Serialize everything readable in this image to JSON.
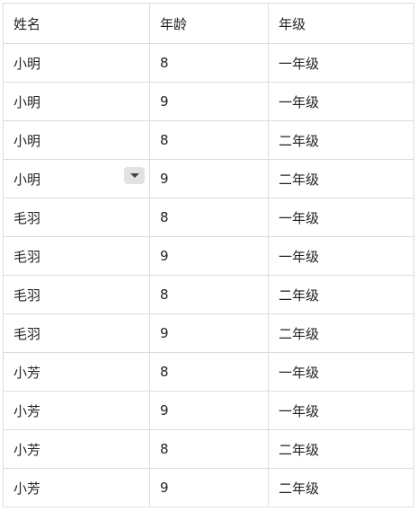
{
  "table": {
    "headers": [
      "姓名",
      "年龄",
      "年级"
    ],
    "rows": [
      [
        "小明",
        "8",
        "一年级"
      ],
      [
        "小明",
        "9",
        "一年级"
      ],
      [
        "小明",
        "8",
        "二年级"
      ],
      [
        "小明",
        "9",
        "二年级"
      ],
      [
        "毛羽",
        "8",
        "一年级"
      ],
      [
        "毛羽",
        "9",
        "一年级"
      ],
      [
        "毛羽",
        "8",
        "二年级"
      ],
      [
        "毛羽",
        "9",
        "二年级"
      ],
      [
        "小芳",
        "8",
        "一年级"
      ],
      [
        "小芳",
        "9",
        "一年级"
      ],
      [
        "小芳",
        "8",
        "二年级"
      ],
      [
        "小芳",
        "9",
        "二年级"
      ]
    ],
    "dropdown_row_index": 3,
    "dropdown_icon": "chevron-down-icon"
  }
}
